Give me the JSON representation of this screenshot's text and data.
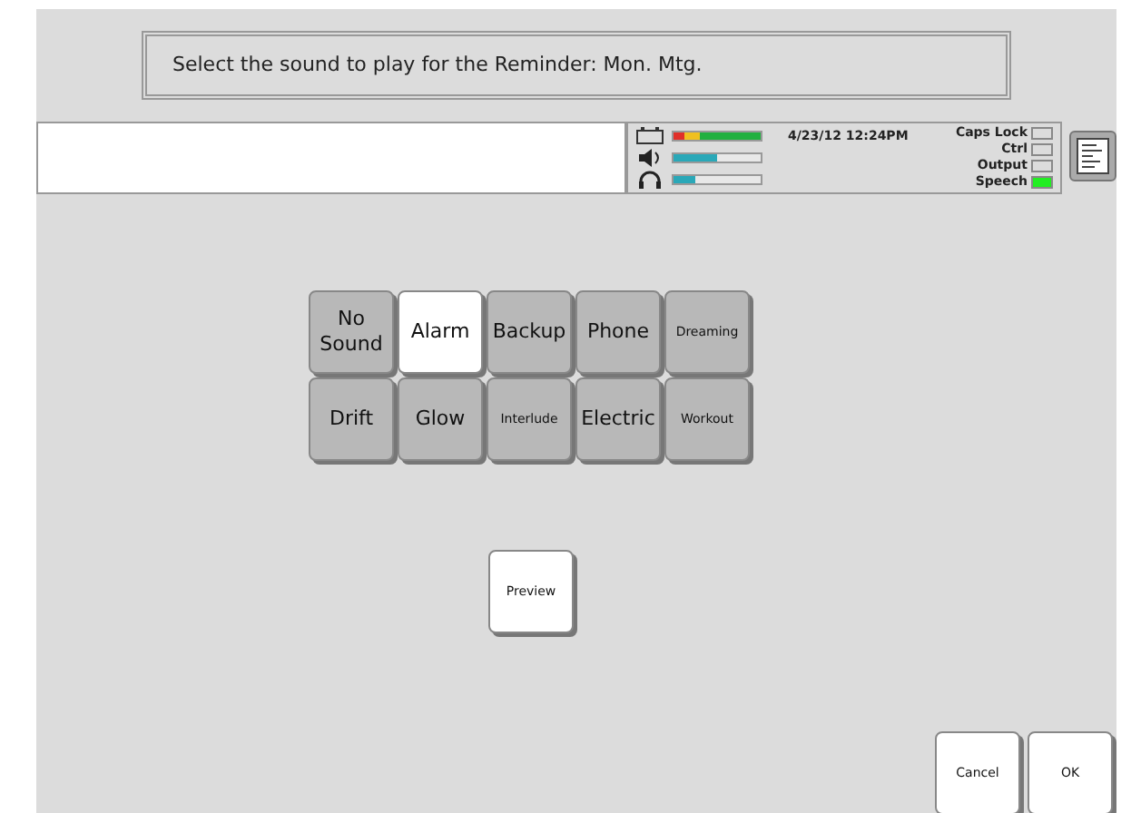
{
  "prompt": "Select the sound to play for the Reminder: Mon. Mtg.",
  "status": {
    "meters": [
      {
        "kind": "battery",
        "level": 1.0
      },
      {
        "kind": "volume",
        "level": 0.5
      },
      {
        "kind": "headphones",
        "level": 0.25
      }
    ],
    "datetime": "4/23/12 12:24PM",
    "indicators": [
      {
        "label": "Caps Lock",
        "on": false
      },
      {
        "label": "Ctrl",
        "on": false
      },
      {
        "label": "Output",
        "on": false
      },
      {
        "label": "Speech",
        "on": true
      }
    ]
  },
  "sounds": [
    {
      "label": "No Sound",
      "kind": "large",
      "selected": false
    },
    {
      "label": "Alarm",
      "kind": "large",
      "selected": true
    },
    {
      "label": "Backup",
      "kind": "large",
      "selected": false
    },
    {
      "label": "Phone",
      "kind": "large",
      "selected": false
    },
    {
      "label": "Dreaming",
      "kind": "small",
      "selected": false
    },
    {
      "label": "Drift",
      "kind": "large",
      "selected": false
    },
    {
      "label": "Glow",
      "kind": "large",
      "selected": false
    },
    {
      "label": "Interlude",
      "kind": "small",
      "selected": false
    },
    {
      "label": "Electric",
      "kind": "large",
      "selected": false
    },
    {
      "label": "Workout",
      "kind": "small",
      "selected": false
    }
  ],
  "preview": "Preview",
  "buttons": [
    "Cancel",
    "OK"
  ]
}
